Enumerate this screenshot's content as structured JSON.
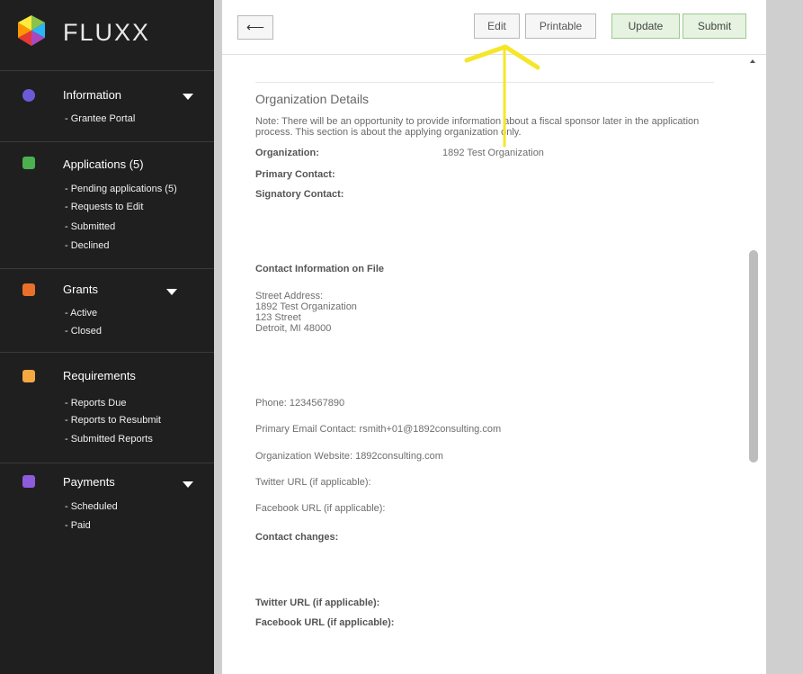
{
  "app": {
    "name": "FLUXX"
  },
  "sidebar": {
    "sections": [
      {
        "title": "Information",
        "icon": "globe-icon",
        "items": [
          "- Grantee Portal"
        ]
      },
      {
        "title": "Applications (5)",
        "icon": "applications-icon",
        "items": [
          "- Pending applications  (5)",
          "- Requests to Edit",
          "- Submitted",
          "- Declined"
        ]
      },
      {
        "title": "Grants",
        "icon": "grants-icon",
        "items": [
          "- Active",
          "- Closed"
        ]
      },
      {
        "title": "Requirements",
        "icon": "requirements-icon",
        "items": [
          "- Reports Due",
          "- Reports to Resubmit",
          "- Submitted Reports"
        ]
      },
      {
        "title": "Payments",
        "icon": "payments-icon",
        "items": [
          "- Scheduled",
          "- Paid"
        ]
      }
    ]
  },
  "toolbar": {
    "back_label": "⟵",
    "edit_label": "Edit",
    "printable_label": "Printable",
    "update_label": "Update",
    "submit_label": "Submit"
  },
  "form": {
    "section_title": "Organization Details",
    "note": "Note: There will be an opportunity to provide information about a fiscal sponsor later in the application process. This section is about the applying organization only.",
    "organization_label": "Organization:",
    "organization_value": "1892 Test Organization",
    "primary_contact_label": "Primary Contact:",
    "signatory_contact_label": "Signatory Contact:",
    "contact_info_label": "Contact Information on File",
    "street_address_label": "Street Address:",
    "address_lines": [
      "1892 Test Organization",
      "123 Street",
      "Detroit, MI 48000"
    ],
    "phone": "Phone: 1234567890",
    "primary_email": "Primary Email Contact: rsmith+01@1892consulting.com",
    "website": "Organization Website: 1892consulting.com",
    "twitter_url": "Twitter URL (if applicable):",
    "facebook_url": "Facebook URL (if applicable):",
    "contact_changes_label": "Contact changes:",
    "twitter_url_bold": "Twitter URL (if applicable):",
    "facebook_url_bold": "Facebook URL (if applicable):"
  },
  "colors": {
    "sidebar_bg": "#1f1f1f",
    "accent_arrow": "#f5e62a",
    "green_button": "#e6f3e1"
  }
}
